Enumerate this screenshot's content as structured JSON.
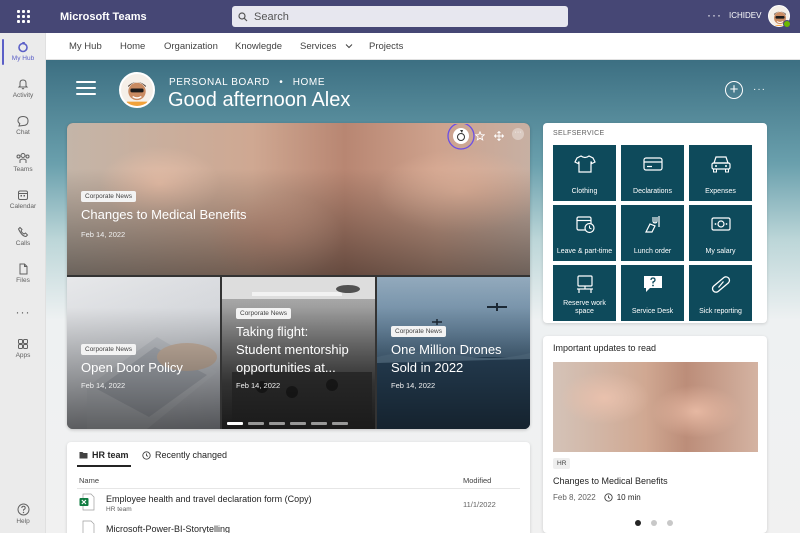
{
  "titlebar": {
    "app_name": "Microsoft Teams",
    "search_placeholder": "Search",
    "more": "···",
    "user_name": "ICHIDEV"
  },
  "rail": {
    "items": [
      {
        "label": "My Hub",
        "icon": "my-hub-icon",
        "active": true
      },
      {
        "label": "Activity",
        "icon": "bell-icon"
      },
      {
        "label": "Chat",
        "icon": "chat-icon"
      },
      {
        "label": "Teams",
        "icon": "teams-icon"
      },
      {
        "label": "Calendar",
        "icon": "calendar-icon"
      },
      {
        "label": "Calls",
        "icon": "phone-icon"
      },
      {
        "label": "Files",
        "icon": "file-icon"
      },
      {
        "label": "Apps",
        "icon": "apps-icon"
      },
      {
        "label": "Help",
        "icon": "help-icon"
      }
    ],
    "more": "···"
  },
  "nav": {
    "items": [
      "My Hub",
      "Home",
      "Organization",
      "Knowlegde",
      "Services",
      "Projects"
    ]
  },
  "header": {
    "breadcrumb_board": "PERSONAL BOARD",
    "breadcrumb_sep": "•",
    "breadcrumb_page": "HOME",
    "greeting": "Good afternoon Alex",
    "more": "···"
  },
  "news": {
    "main": {
      "tag": "Corporate News",
      "title": "Changes to Medical Benefits",
      "date": "Feb 14, 2022"
    },
    "tiles": [
      {
        "tag": "Corporate News",
        "title_lines": [
          "Open Door Policy"
        ],
        "date": "Feb 14, 2022"
      },
      {
        "tag": "Corporate News",
        "title_lines": [
          "Taking flight:",
          "Student mentorship",
          "opportunities at..."
        ],
        "date": "Feb 14, 2022"
      },
      {
        "tag": "Corporate News",
        "title_lines": [
          "One Million Drones",
          "Sold in 2022"
        ],
        "date": "Feb 14, 2022"
      }
    ],
    "tools_more": "···"
  },
  "selfservice": {
    "title": "SELFSERVICE",
    "tiles": [
      {
        "label": "Clothing",
        "icon": "shirt-icon"
      },
      {
        "label": "Declarations",
        "icon": "card-icon"
      },
      {
        "label": "Expenses",
        "icon": "car-icon"
      },
      {
        "label": "Leave & part-time",
        "icon": "calendar-clock-icon"
      },
      {
        "label": "Lunch order",
        "icon": "food-icon"
      },
      {
        "label": "My salary",
        "icon": "money-icon"
      },
      {
        "label": "Reserve work space",
        "icon": "desk-icon"
      },
      {
        "label": "Service Desk",
        "icon": "question-icon"
      },
      {
        "label": "Sick reporting",
        "icon": "pill-icon"
      }
    ]
  },
  "updates": {
    "title": "Important updates to read",
    "tag": "HR",
    "headline": "Changes to Medical Benefits",
    "date": "Feb 8, 2022",
    "read_time": "10 min"
  },
  "hr": {
    "tab_active": "HR team",
    "tab_other": "Recently changed",
    "col_name": "Name",
    "col_modified": "Modified",
    "rows": [
      {
        "name": "Employee health and travel declaration form (Copy)",
        "sub": "HR team",
        "date": "11/1/2022"
      },
      {
        "name": "Microsoft-Power-BI-Storytelling",
        "sub": "",
        "date": ""
      }
    ]
  },
  "colors": {
    "brand": "#464775",
    "accent": "#5b5fc7",
    "tile": "#0e4a5b"
  }
}
